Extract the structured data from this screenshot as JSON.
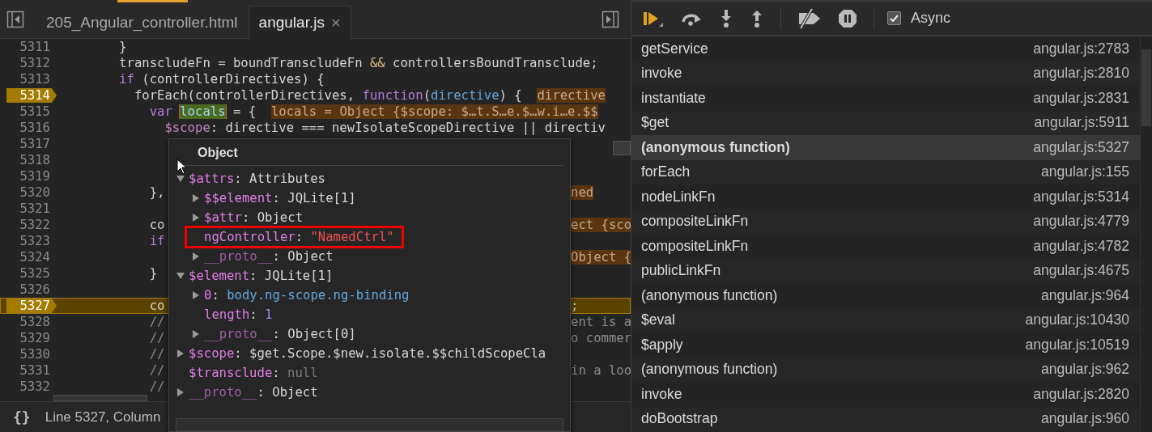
{
  "editor": {
    "tabs": [
      {
        "label": "205_Angular_controller.html",
        "selected": false,
        "closable": false
      },
      {
        "label": "angular.js",
        "selected": true,
        "closable": true,
        "close": "×"
      }
    ],
    "lines": [
      {
        "number": "5311",
        "breakpoint": false,
        "current": false,
        "left": [
          {
            "kind": "plain",
            "text": "        }"
          }
        ]
      },
      {
        "number": "5312",
        "breakpoint": false,
        "current": false,
        "left": [
          {
            "kind": "plain",
            "text": "        transcludeFn = boundTranscludeFn "
          },
          {
            "kind": "operator",
            "text": "&&"
          },
          {
            "kind": "plain",
            "text": " controllersBoundTransclude;"
          }
        ]
      },
      {
        "number": "5313",
        "breakpoint": false,
        "current": false,
        "left": [
          {
            "kind": "keyword",
            "text": "        if"
          },
          {
            "kind": "plain",
            "text": " (controllerDirectives) {"
          }
        ]
      },
      {
        "number": "5314",
        "breakpoint": true,
        "current": false,
        "left": [
          {
            "kind": "plain",
            "text": "          forEach(controllerDirectives, "
          },
          {
            "kind": "keyword",
            "text": "function"
          },
          {
            "kind": "plain",
            "text": "("
          },
          {
            "kind": "param",
            "text": "directive"
          },
          {
            "kind": "plain",
            "text": ") {  "
          },
          {
            "kind": "value",
            "text": "directive"
          }
        ]
      },
      {
        "number": "5315",
        "breakpoint": false,
        "current": false,
        "left": [
          {
            "kind": "keyword",
            "text": "            var "
          },
          {
            "kind": "hover",
            "text": "locals"
          },
          {
            "kind": "plain",
            "text": " = {  "
          },
          {
            "kind": "value",
            "text": "locals = Object {$scope: $…t.S…e.$…w.i…e.$$"
          }
        ]
      },
      {
        "number": "5316",
        "breakpoint": false,
        "current": false,
        "left": [
          {
            "kind": "property",
            "text": "              $scope"
          },
          {
            "kind": "plain",
            "text": ": directive === newIsolateScopeDirective || directiv"
          }
        ]
      },
      {
        "number": "5317",
        "breakpoint": false,
        "current": false
      },
      {
        "number": "5318",
        "breakpoint": false,
        "current": false
      },
      {
        "number": "5319",
        "breakpoint": false,
        "current": false
      },
      {
        "number": "5320",
        "breakpoint": false,
        "current": false,
        "left": [
          {
            "kind": "plain",
            "text": "            },"
          }
        ],
        "right": [
          {
            "kind": "value",
            "text": "ned"
          }
        ]
      },
      {
        "number": "5321",
        "breakpoint": false,
        "current": false
      },
      {
        "number": "5322",
        "breakpoint": false,
        "current": false,
        "left": [
          {
            "kind": "plain",
            "text": "            co"
          }
        ],
        "right": [
          {
            "kind": "value",
            "text": "ect {sco"
          }
        ]
      },
      {
        "number": "5323",
        "breakpoint": false,
        "current": false,
        "left": [
          {
            "kind": "keyword",
            "text": "            if"
          }
        ]
      },
      {
        "number": "5324",
        "breakpoint": false,
        "current": false,
        "right": [
          {
            "kind": "value",
            "text": "Object {"
          }
        ]
      },
      {
        "number": "5325",
        "breakpoint": false,
        "current": false,
        "left": [
          {
            "kind": "plain",
            "text": "            }"
          }
        ]
      },
      {
        "number": "5326",
        "breakpoint": false,
        "current": false
      },
      {
        "number": "5327",
        "breakpoint": true,
        "current": true,
        "left": [
          {
            "kind": "plain",
            "text": "            co"
          }
        ],
        "right": [
          {
            "kind": "plain",
            "text": ";"
          }
        ]
      },
      {
        "number": "5328",
        "breakpoint": false,
        "current": false,
        "left": [
          {
            "kind": "comment",
            "text": "            //"
          }
        ],
        "right": [
          {
            "kind": "comment",
            "text": "ent is a"
          }
        ]
      },
      {
        "number": "5329",
        "breakpoint": false,
        "current": false,
        "left": [
          {
            "kind": "comment",
            "text": "            //"
          }
        ],
        "right": [
          {
            "kind": "comment",
            "text": "o commer"
          }
        ]
      },
      {
        "number": "5330",
        "breakpoint": false,
        "current": false,
        "left": [
          {
            "kind": "comment",
            "text": "            //"
          }
        ]
      },
      {
        "number": "5331",
        "breakpoint": false,
        "current": false,
        "left": [
          {
            "kind": "comment",
            "text": "            //"
          }
        ],
        "right": [
          {
            "kind": "comment",
            "text": "in a loo"
          }
        ]
      },
      {
        "number": "5332",
        "breakpoint": false,
        "current": false,
        "left": [
          {
            "kind": "comment",
            "text": "            //"
          }
        ]
      }
    ],
    "status": {
      "format": "{}",
      "position": "Line 5327, Column"
    }
  },
  "popover": {
    "title": "Object",
    "tree": [
      {
        "name": "$attrs",
        "colon": ":",
        "value": "Attributes",
        "kind": "object",
        "dim": false,
        "expanded": true,
        "children": [
          {
            "name": "$$element",
            "colon": ":",
            "value": "JQLite[1]",
            "kind": "object",
            "dim": false,
            "expanded": false
          },
          {
            "name": "$attr",
            "colon": ":",
            "value": "Object",
            "kind": "object",
            "dim": false,
            "expanded": false
          },
          {
            "name": "ngController",
            "colon": ":",
            "value": "\"NamedCtrl\"",
            "kind": "string",
            "dim": false,
            "highlighted": true
          },
          {
            "name": "__proto__",
            "colon": ":",
            "value": "Object",
            "kind": "object",
            "dim": true,
            "expanded": false
          }
        ]
      },
      {
        "name": "$element",
        "colon": ":",
        "value": "JQLite[1]",
        "kind": "object",
        "dim": false,
        "expanded": true,
        "children": [
          {
            "name": "0",
            "colon": ":",
            "value": "body.ng-scope.ng-binding",
            "kind": "node",
            "dim": false,
            "expanded": false
          },
          {
            "name": "length",
            "colon": ":",
            "value": "1",
            "kind": "number",
            "dim": false
          },
          {
            "name": "__proto__",
            "colon": ":",
            "value": "Object[0]",
            "kind": "object",
            "dim": true,
            "expanded": false
          }
        ]
      },
      {
        "name": "$scope",
        "colon": ":",
        "value": "$get.Scope.$new.isolate.$$childScopeCla",
        "kind": "object",
        "dim": false,
        "expanded": false
      },
      {
        "name": "$transclude",
        "colon": ":",
        "value": "null",
        "kind": "null",
        "dim": false
      },
      {
        "name": "__proto__",
        "colon": ":",
        "value": "Object",
        "kind": "object",
        "dim": true,
        "expanded": false
      }
    ]
  },
  "debugger": {
    "async": {
      "label": "Async",
      "checked": true
    },
    "frames": [
      {
        "name": "getService",
        "location": "angular.js:2783",
        "selected": false
      },
      {
        "name": "invoke",
        "location": "angular.js:2810",
        "selected": false
      },
      {
        "name": "instantiate",
        "location": "angular.js:2831",
        "selected": false
      },
      {
        "name": "$get",
        "location": "angular.js:5911",
        "selected": false
      },
      {
        "name": "(anonymous function)",
        "location": "angular.js:5327",
        "selected": true
      },
      {
        "name": "forEach",
        "location": "angular.js:155",
        "selected": false
      },
      {
        "name": "nodeLinkFn",
        "location": "angular.js:5314",
        "selected": false
      },
      {
        "name": "compositeLinkFn",
        "location": "angular.js:4779",
        "selected": false
      },
      {
        "name": "compositeLinkFn",
        "location": "angular.js:4782",
        "selected": false
      },
      {
        "name": "publicLinkFn",
        "location": "angular.js:4675",
        "selected": false
      },
      {
        "name": "(anonymous function)",
        "location": "angular.js:964",
        "selected": false
      },
      {
        "name": "$eval",
        "location": "angular.js:10430",
        "selected": false
      },
      {
        "name": "$apply",
        "location": "angular.js:10519",
        "selected": false
      },
      {
        "name": "(anonymous function)",
        "location": "angular.js:962",
        "selected": false
      },
      {
        "name": "invoke",
        "location": "angular.js:2820",
        "selected": false
      },
      {
        "name": "doBootstrap",
        "location": "angular.js:960",
        "selected": false
      }
    ]
  }
}
